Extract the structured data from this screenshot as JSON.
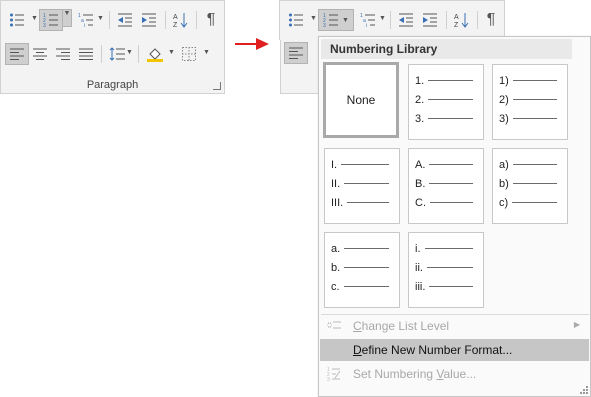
{
  "ribbon": {
    "group_label": "Paragraph",
    "launcher_icon": "dialog-launcher-icon",
    "buttons_row1": [
      "bullets",
      "numbering",
      "multilevel-list",
      "decrease-indent",
      "increase-indent",
      "sort",
      "show-hide"
    ],
    "buttons_row2": [
      "align-left",
      "center",
      "align-right",
      "justify",
      "line-spacing",
      "shading",
      "borders"
    ],
    "show_hide_glyph": "¶"
  },
  "arrow_color": "#e02020",
  "numbering_dropdown": {
    "header": "Numbering Library",
    "tiles": [
      {
        "type": "none",
        "label": "None",
        "selected": true
      },
      {
        "type": "list",
        "labels": [
          "1.",
          "2.",
          "3."
        ]
      },
      {
        "type": "list",
        "labels": [
          "1)",
          "2)",
          "3)"
        ]
      },
      {
        "type": "list",
        "labels": [
          "I.",
          "II.",
          "III."
        ]
      },
      {
        "type": "list",
        "labels": [
          "A.",
          "B.",
          "C."
        ]
      },
      {
        "type": "list",
        "labels": [
          "a)",
          "b)",
          "c)"
        ]
      },
      {
        "type": "list",
        "labels": [
          "a.",
          "b.",
          "c."
        ]
      },
      {
        "type": "list",
        "labels": [
          "i.",
          "ii.",
          "iii."
        ]
      }
    ],
    "menu": {
      "change_list_level": {
        "pre": "",
        "mn": "C",
        "post": "hange List Level",
        "enabled": false,
        "icon": "change-level-icon",
        "has_submenu": true
      },
      "define_new_format": {
        "pre": "",
        "mn": "D",
        "post": "efine New Number Format...",
        "enabled": true,
        "highlighted": true
      },
      "set_numbering_value": {
        "pre": "Set Numbering ",
        "mn": "V",
        "post": "alue...",
        "enabled": false,
        "icon": "set-value-icon"
      }
    }
  }
}
